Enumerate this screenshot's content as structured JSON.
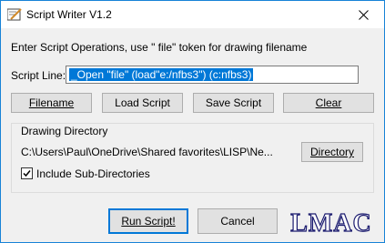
{
  "window": {
    "title": "Script Writer V1.2"
  },
  "instructions": "Enter Script Operations, use \" file\"  token for drawing filename",
  "script_line": {
    "label": "Script Line:",
    "value": "_Open \"file\" (load\"e:/nfbs3\") (c:nfbs3)"
  },
  "buttons": {
    "filename": "Filename",
    "load_script": "Load Script",
    "save_script": "Save Script",
    "clear": "Clear",
    "directory": "Directory",
    "run_script": "Run Script!",
    "cancel": "Cancel"
  },
  "drawing_directory": {
    "title": "Drawing Directory",
    "path": "C:\\Users\\Paul\\OneDrive\\Shared favorites\\LISP\\Ne...",
    "include_subdirs_label": "Include Sub-Directories",
    "include_subdirs_checked": true
  },
  "logo_text": "LMAC",
  "colors": {
    "accent": "#0078d7",
    "window_border": "#1883d7",
    "face": "#f0f0f0"
  }
}
